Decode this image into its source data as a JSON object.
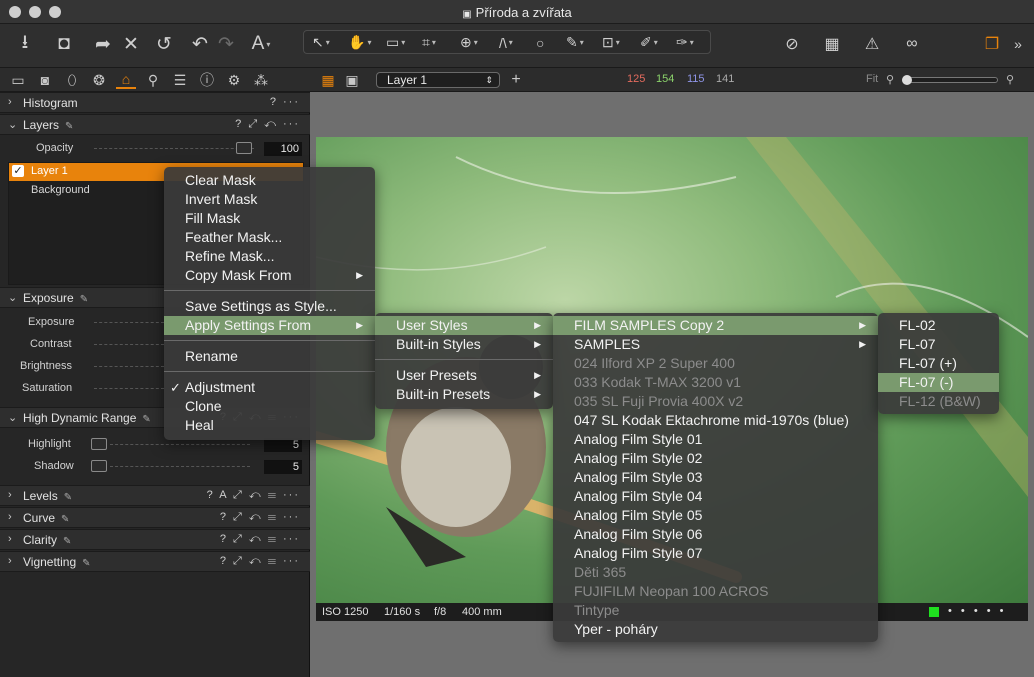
{
  "window": {
    "title": "Příroda a zvířata"
  },
  "toolbar": {
    "text_tool_label": "A"
  },
  "viewer_bar": {
    "layer_select_value": "Layer 1",
    "rgb": {
      "r": "125",
      "g": "154",
      "b": "115",
      "k": "141"
    },
    "fit_label": "Fit"
  },
  "colors": {
    "accent": "#e8830c",
    "rgb_r": "#e46b5e",
    "rgb_g": "#8bd36b",
    "rgb_b": "#8f95e8",
    "menu_highlight": "#7a9a6e"
  },
  "panel": {
    "histogram": {
      "title": "Histogram",
      "icons": "? ···"
    },
    "layers": {
      "title": "Layers",
      "icons": "? ⤢ ↶ ···",
      "opacity_label": "Opacity",
      "opacity_value": "100",
      "items": [
        {
          "label": "Layer 1",
          "checked": true,
          "selected": true
        },
        {
          "label": "Background"
        }
      ]
    },
    "exposure": {
      "title": "Exposure",
      "rows": [
        "Exposure",
        "Contrast",
        "Brightness",
        "Saturation"
      ]
    },
    "hdr": {
      "title": "High Dynamic Range",
      "icons": "? ⤢ ↶ ☰ ···",
      "rows": [
        {
          "label": "Highlight",
          "value": "5"
        },
        {
          "label": "Shadow",
          "value": "5"
        }
      ]
    },
    "collapsed": [
      {
        "title": "Levels",
        "icons": "? A ⤢ ↶ ☰ ···"
      },
      {
        "title": "Curve",
        "icons": "? ⤢ ↶ ☰ ···"
      },
      {
        "title": "Clarity",
        "icons": "? ⤢ ↶ ☰ ···"
      },
      {
        "title": "Vignetting",
        "icons": "? ⤢ ↶ ☰ ···"
      }
    ]
  },
  "photo_info": {
    "iso": "ISO 1250",
    "shutter": "1/160 s",
    "aperture": "f/8",
    "focal": "400 mm"
  },
  "context_menu": {
    "items": [
      "Clear Mask",
      "Invert Mask",
      "Fill Mask",
      "Feather Mask...",
      "Refine Mask...",
      "Copy Mask From",
      "Save Settings as Style...",
      "Apply Settings From",
      "Rename",
      "Adjustment",
      "Clone",
      "Heal"
    ]
  },
  "submenu_apply": {
    "items": [
      "User Styles",
      "Built-in Styles",
      "User Presets",
      "Built-in Presets"
    ]
  },
  "submenu_user_styles": {
    "items": [
      "FILM SAMPLES Copy 2",
      "SAMPLES",
      "024 Ilford XP 2 Super 400",
      "033 Kodak T-MAX 3200 v1",
      "035 SL Fuji Provia 400X v2",
      "047 SL Kodak Ektachrome mid-1970s (blue)",
      "Analog Film Style 01",
      "Analog Film Style 02",
      "Analog Film Style 03",
      "Analog Film Style 04",
      "Analog Film Style 05",
      "Analog Film Style 06",
      "Analog Film Style 07",
      "Děti 365",
      "FUJIFILM Neopan 100 ACROS",
      "Tintype",
      "Yper - poháry"
    ]
  },
  "submenu_film": {
    "items": [
      "FL-02",
      "FL-07",
      "FL-07 (+)",
      "FL-07 (-)",
      "FL-12 (B&W)"
    ]
  }
}
